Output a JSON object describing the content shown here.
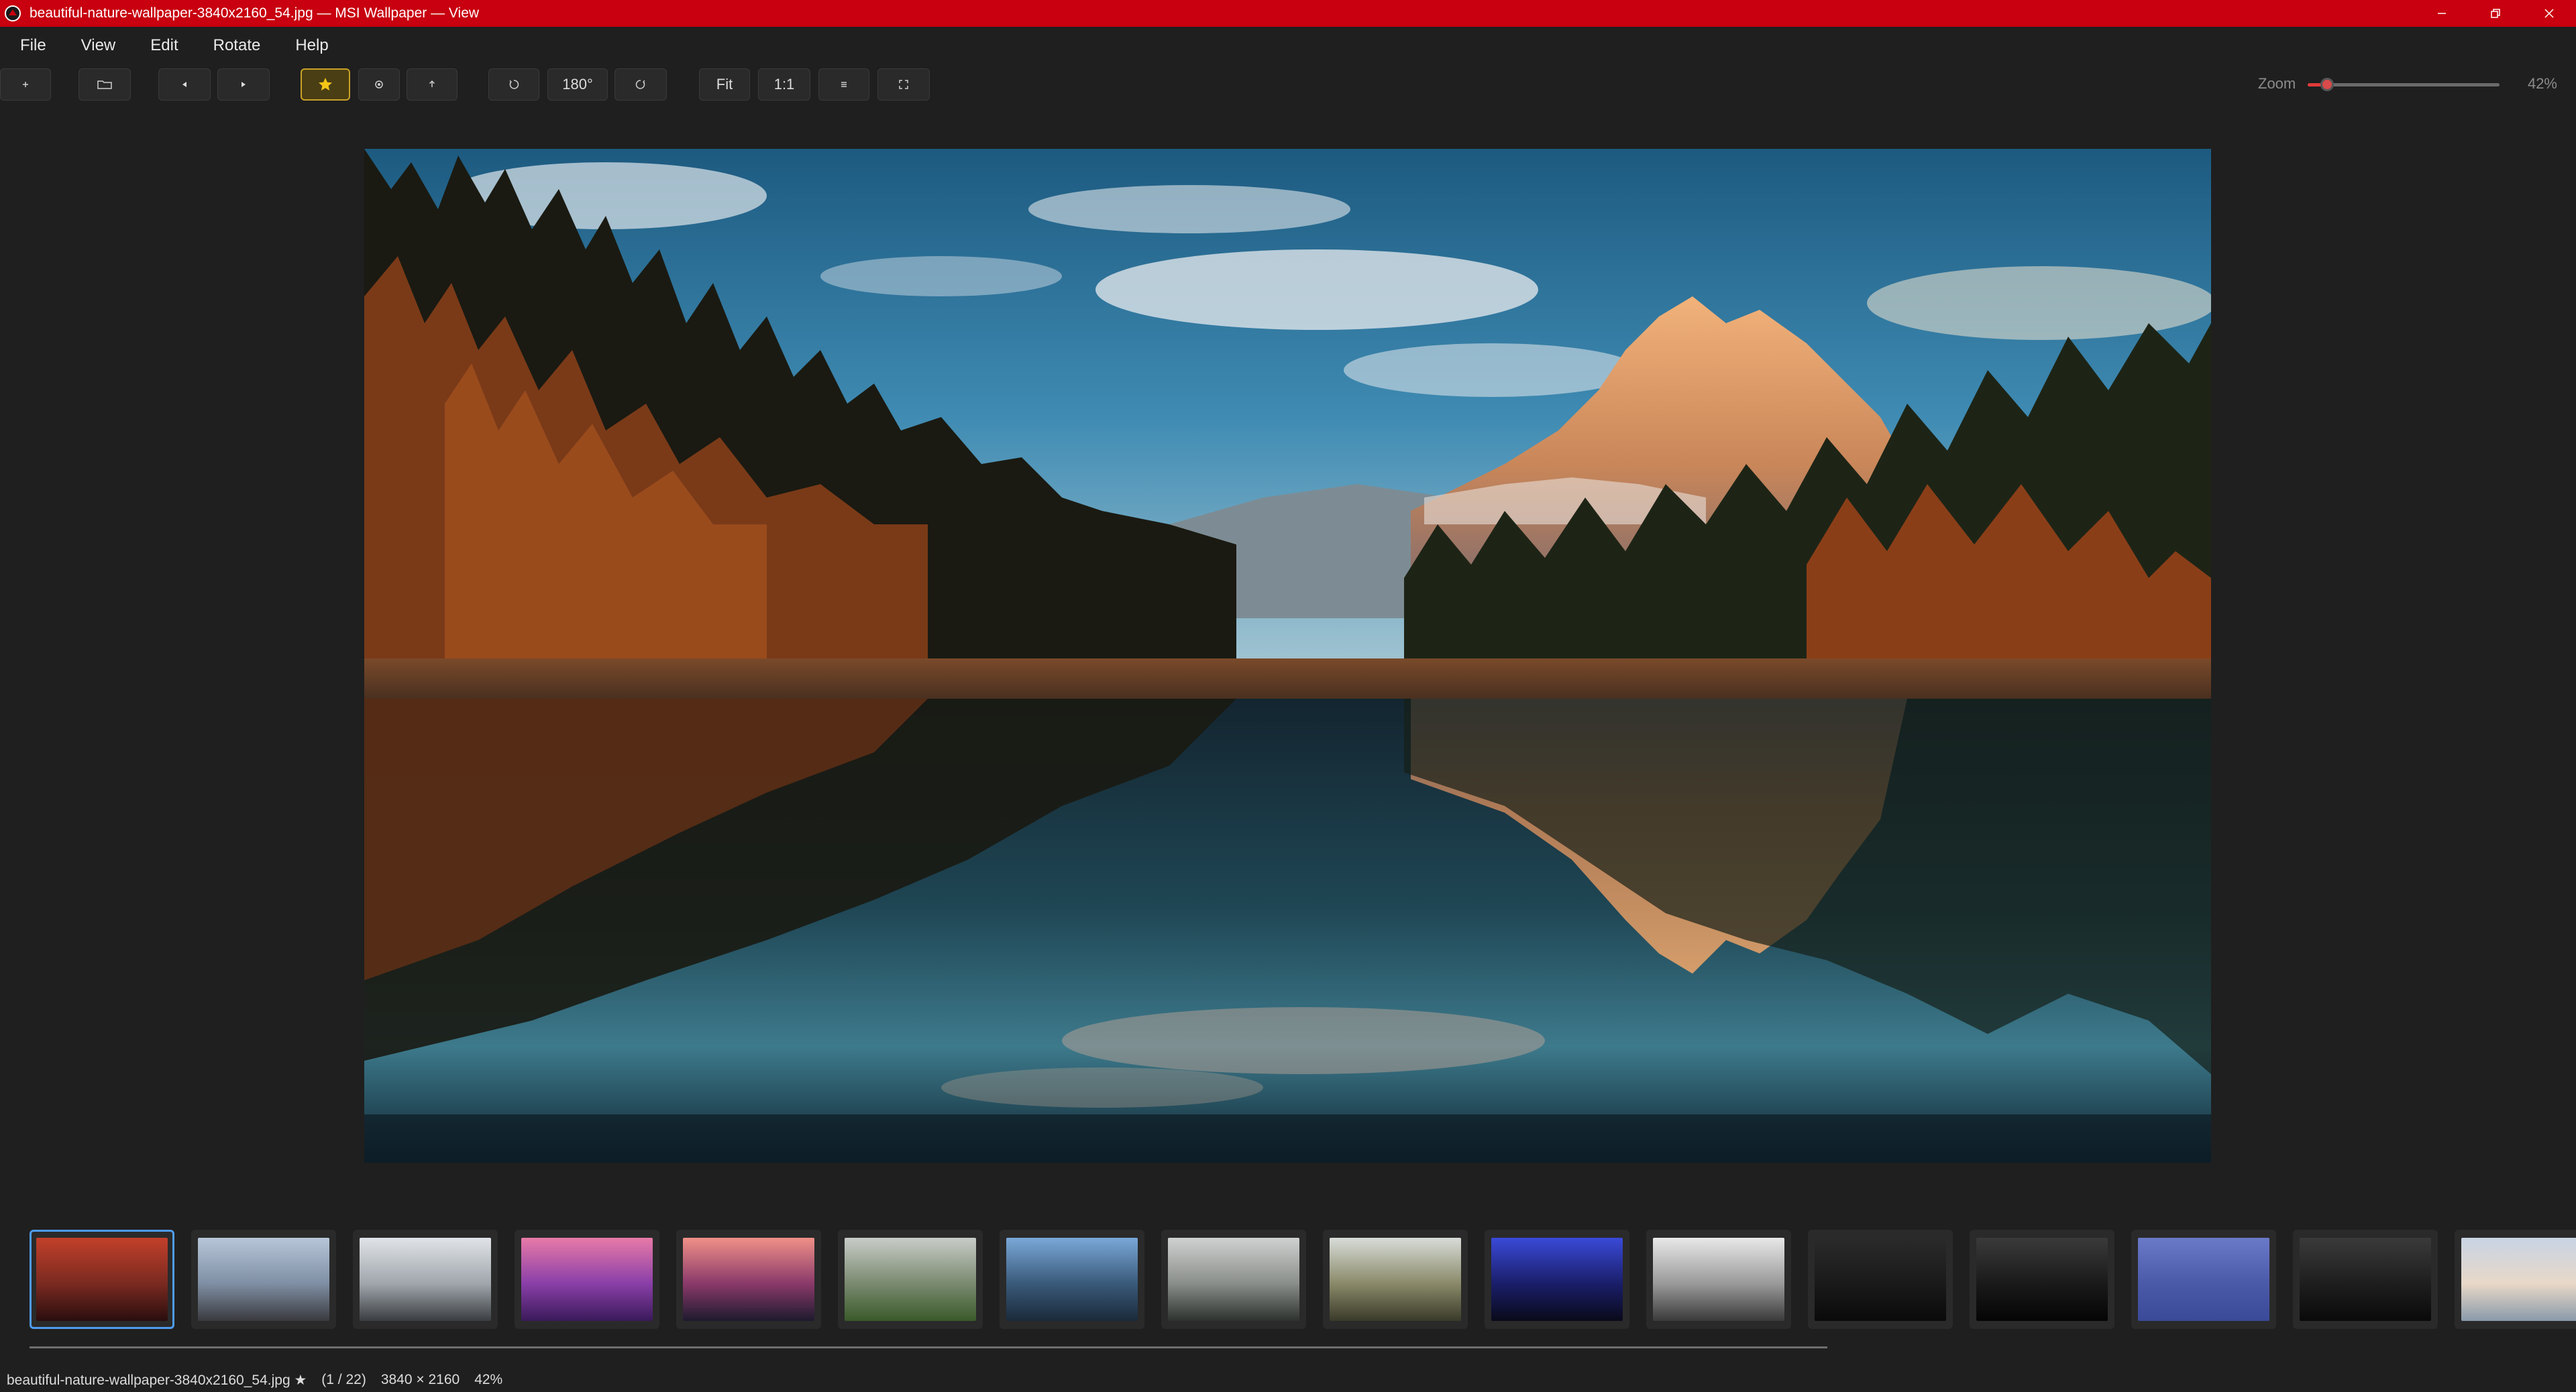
{
  "window": {
    "title": "beautiful-nature-wallpaper-3840x2160_54.jpg — MSI Wallpaper — View",
    "title_bar_color": "#c8000f"
  },
  "menu": {
    "items": [
      "File",
      "View",
      "Edit",
      "Rotate",
      "Help"
    ]
  },
  "toolbar": {
    "add_icon": "plus-icon",
    "open_icon": "folder-icon",
    "prev_icon": "triangle-left-icon",
    "next_icon": "triangle-right-icon",
    "favorite_icon": "star-icon",
    "favorite_active": true,
    "favorite_color": "#f5c518",
    "info_icon": "circle-icon",
    "share_icon": "upload-icon",
    "rotate_left_icon": "rotate-left-icon",
    "rotate_180_label": "180°",
    "rotate_right_icon": "rotate-right-icon",
    "fit_label": "Fit",
    "actual_size_label": "1:1",
    "menu_icon": "hamburger-icon",
    "fullscreen_icon": "fullscreen-icon"
  },
  "zoom": {
    "label": "Zoom",
    "value_text": "42%",
    "slider_fraction": 0.1,
    "accent_color": "#e23a3a"
  },
  "filmstrip": {
    "selected_index": 0,
    "thumbnails": [
      {
        "name": "red-lake-sunset",
        "colors": [
          "#c2402a",
          "#7a2a20",
          "#2a0e0e"
        ]
      },
      {
        "name": "rocky-coast-dusk",
        "colors": [
          "#b7c6d8",
          "#7f8fa4",
          "#3a3a3e"
        ]
      },
      {
        "name": "misty-coast",
        "colors": [
          "#e0e4e8",
          "#a0a6ac",
          "#3a3e42"
        ]
      },
      {
        "name": "purple-lake",
        "colors": [
          "#e87aa8",
          "#8a3fa8",
          "#3a1a5a"
        ]
      },
      {
        "name": "pink-sky-hills",
        "colors": [
          "#f09088",
          "#8a3a6a",
          "#1e1a2e"
        ]
      },
      {
        "name": "foggy-forest",
        "colors": [
          "#c8ccc8",
          "#7a8a70",
          "#3a5a2a"
        ]
      },
      {
        "name": "blue-coastline",
        "colors": [
          "#7aa8d8",
          "#3a5a7a",
          "#1a2a3a"
        ]
      },
      {
        "name": "misty-pines",
        "colors": [
          "#cfd2d0",
          "#8a8e8a",
          "#2e322e"
        ]
      },
      {
        "name": "mountain-valley",
        "colors": [
          "#d8dcd8",
          "#8a8a6a",
          "#3a3a2a"
        ]
      },
      {
        "name": "msi-gaming-stage",
        "colors": [
          "#3a4ad8",
          "#1a1e6a",
          "#0a0a1a"
        ]
      },
      {
        "name": "msi-dragon-silver",
        "colors": [
          "#e8e8e8",
          "#9a9a9a",
          "#3a3a3a"
        ]
      },
      {
        "name": "dark-laptop-gold",
        "colors": [
          "#2a2a2a",
          "#1a1a1a",
          "#0a0a0a"
        ]
      },
      {
        "name": "dark-disc",
        "colors": [
          "#3a3a3a",
          "#1a1a1a",
          "#050505"
        ]
      },
      {
        "name": "blue-msi-logo",
        "colors": [
          "#6a7ac8",
          "#4a5aa8",
          "#3a4a98"
        ]
      },
      {
        "name": "msi-black-laptop",
        "colors": [
          "#3a3a3a",
          "#1e1e1e",
          "#0a0a0a"
        ]
      },
      {
        "name": "pastel-beach",
        "colors": [
          "#c8d4e4",
          "#e8d8c8",
          "#8a9aaa"
        ]
      }
    ]
  },
  "status": {
    "filename": "beautiful-nature-wallpaper-3840x2160_54.jpg ★",
    "position": "(1 / 22)",
    "dimensions": "3840 × 2160",
    "zoom": "42%"
  }
}
